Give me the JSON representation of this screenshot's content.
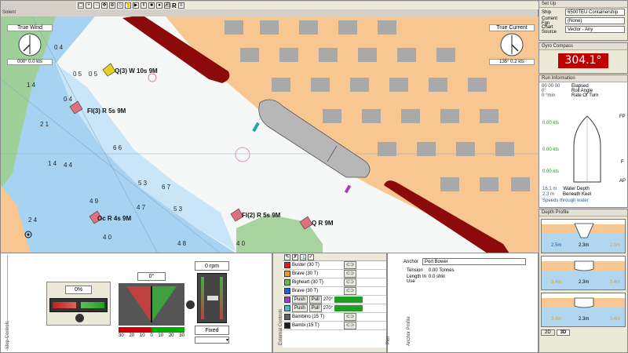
{
  "chart_window": {
    "title": "Solent",
    "toolbar_letter": "R",
    "true_wind": {
      "label": "True Wind",
      "value": "000° 0.0 kts"
    },
    "true_current": {
      "label": "True Current",
      "value": "135° 0.2 kts"
    },
    "depths": [
      "0 4",
      "0 5",
      "1 4",
      "0 4",
      "2 1",
      "1 4",
      "4 4",
      "6 6",
      "5 3",
      "6 7",
      "4 9",
      "4 7",
      "5 3",
      "4 0",
      "4 8",
      "4 0",
      "2 4",
      "0 5"
    ],
    "lights": [
      {
        "text": "Q(3) W 10s 9M"
      },
      {
        "text": "Fl(3) R 5s 9M"
      },
      {
        "text": "Oc R 4s 9M"
      },
      {
        "text": "Fl(2) R 5s 9M"
      },
      {
        "text": "Q R 9M"
      }
    ]
  },
  "setup": {
    "title": "Set Up",
    "ship_label": "Ship",
    "ship_value": "6500TEU Containership",
    "current_label": "Current Fgn",
    "current_value": "(None)",
    "chart_label": "Chart Source",
    "chart_value": "Vector - Any"
  },
  "gyro": {
    "title": "Gyro Compass",
    "value": "304.1°"
  },
  "run_info": {
    "title": "Run Information",
    "elapsed_value": "00 00 00",
    "elapsed_label": "Elapsed",
    "roll_value": "0°",
    "roll_label": "Roll Angle",
    "rot_value": "0 °min",
    "rot_label": "Rate Of Turn",
    "speed_fwd": "0.00 kts",
    "speed_mid": "0.00 kts",
    "speed_aft": "0.00 kts",
    "fp": "FP",
    "ap": "AP",
    "f_mark": "F",
    "depth_value": "16.1 m",
    "depth_label": "Water Depth",
    "keel_value": "2.3 m",
    "keel_label": "Beneath Keel",
    "speeds_note": "Speeds through water"
  },
  "depth_profile": {
    "title": "Depth Profile",
    "rows": [
      {
        "left": "2.5m",
        "mid": "2.3m",
        "right": "2.5m"
      },
      {
        "left": "3.4m",
        "mid": "2.3m",
        "right": "3.4m"
      },
      {
        "left": "3.4m",
        "mid": "2.3m",
        "right": "3.4m"
      }
    ],
    "tab_2d": "2D",
    "tab_3d": "3D"
  },
  "ship_controls": {
    "side_label": "Ship Controls",
    "thruster_value": "0%",
    "rudder_value": "0°",
    "rudder_scale": [
      "30",
      "20",
      "10",
      "0",
      "10",
      "20",
      "30"
    ],
    "engine_value": "0 rpm",
    "engine_mode": "Fixed"
  },
  "external_controls": {
    "side_label": "External Controls",
    "tugs": [
      {
        "name": "Buster (30 T)",
        "color": "#e02020"
      },
      {
        "name": "Brave (30 T)",
        "color": "#e0a020"
      },
      {
        "name": "Bigheart (30 T)",
        "color": "#60c040"
      },
      {
        "name": "Brave (30 T)",
        "color": "#2060e0"
      },
      {
        "name": "Push",
        "pull": "Pull",
        "angle": "270°",
        "color": "#a040c0"
      },
      {
        "name": "Push",
        "pull": "Pull",
        "angle": "270°",
        "color": "#40c0c0"
      },
      {
        "name": "Bambino (15 T)",
        "color": "#606060"
      },
      {
        "name": "Bambi (15 T)",
        "color": "#202020"
      }
    ]
  },
  "anchor_profile": {
    "side_label": "Anchor Profile",
    "plot_label": "Plot",
    "anchor_label": "Anchor",
    "anchor_value": "Port Bower",
    "tension_label": "Tension",
    "tension_value": "0.00 Tonnes",
    "length_label": "Length In Use",
    "length_value": "0.0 shkl"
  }
}
